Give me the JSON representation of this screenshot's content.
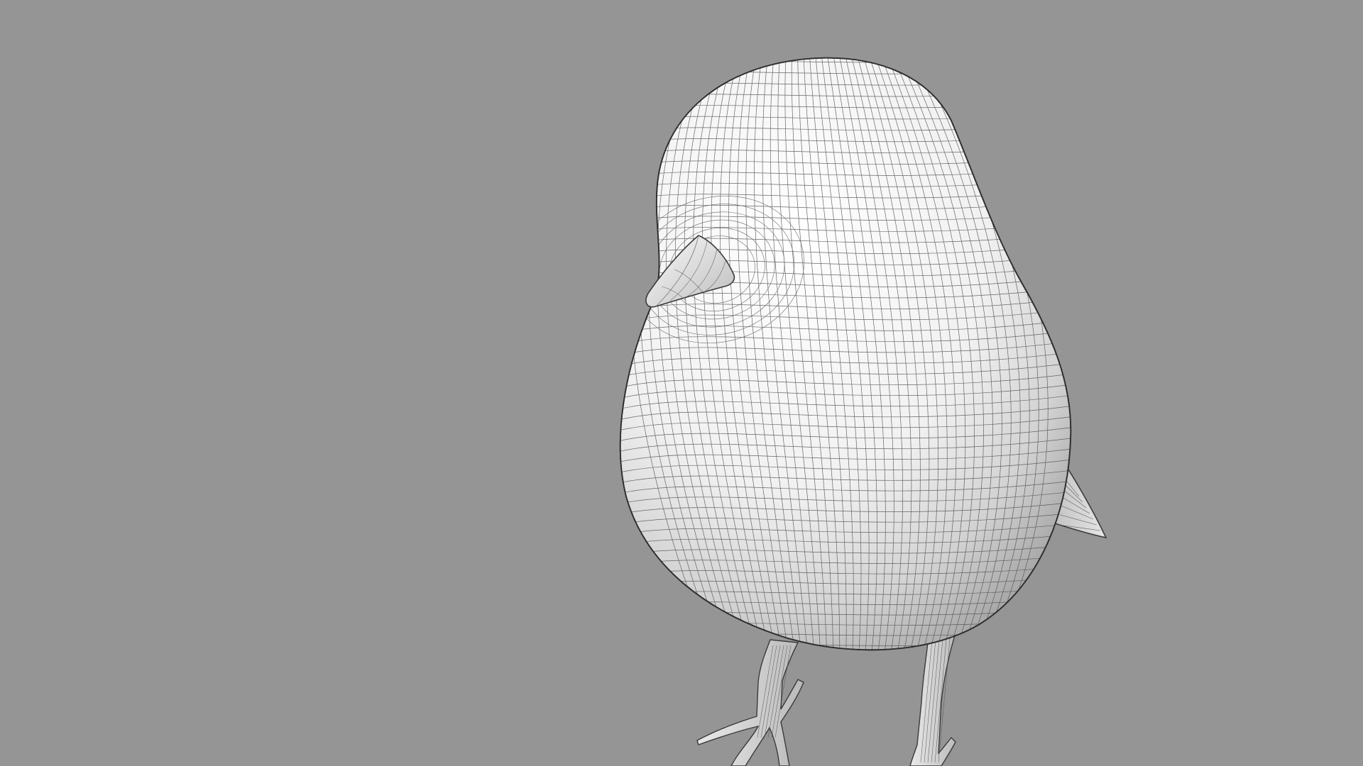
{
  "scene": {
    "background_color": "#959595",
    "model_fill_color": "#f3f3f3",
    "outline_color": "#3a3a3a",
    "wireframe_color": "#4f4f4f",
    "shade_color": "#9c9c9c",
    "display_mode": "wireframe-on-shaded",
    "model_parts": [
      "bird-body",
      "bird-beak",
      "bird-tail",
      "left-leg",
      "right-leg"
    ]
  }
}
